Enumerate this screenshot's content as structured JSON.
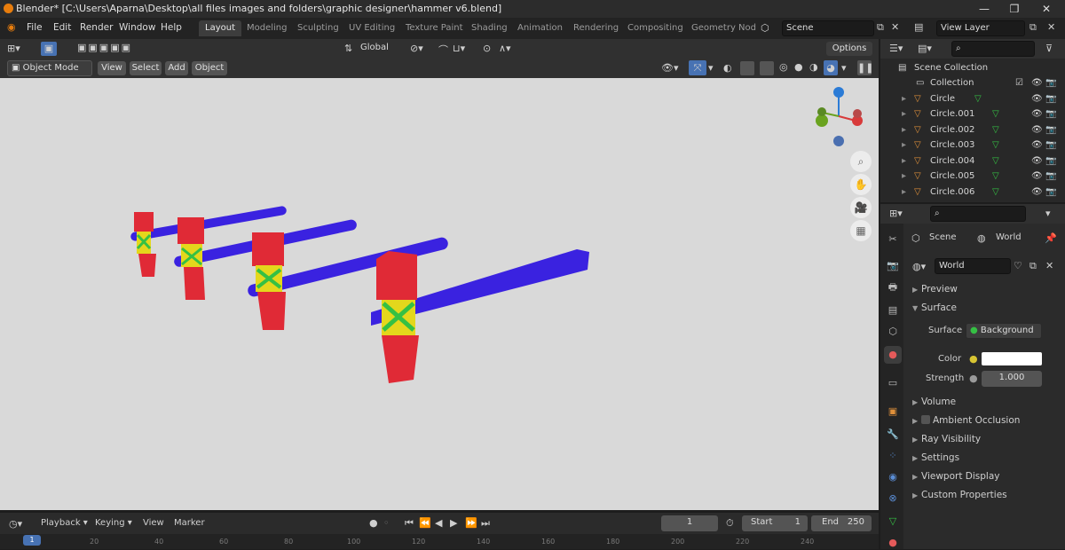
{
  "window": {
    "title": "Blender* [C:\\Users\\Aparna\\Desktop\\all files images and folders\\graphic designer\\hammer v6.blend]",
    "minimize": "—",
    "maximize": "❐",
    "close": "✕"
  },
  "menubar": {
    "items": [
      "File",
      "Edit",
      "Render",
      "Window",
      "Help"
    ],
    "workspaces": [
      "Layout",
      "Modeling",
      "Sculpting",
      "UV Editing",
      "Texture Paint",
      "Shading",
      "Animation",
      "Rendering",
      "Compositing",
      "Geometry Nod"
    ],
    "scene": "Scene",
    "view_layer": "View Layer"
  },
  "viewport_header": {
    "orientation": "Global",
    "options": "Options"
  },
  "viewport_tools": {
    "mode": "Object Mode",
    "menus": [
      "View",
      "Select",
      "Add",
      "Object"
    ]
  },
  "colors": {
    "handle": "#3a22e0",
    "head": "#e02a36",
    "band_yellow": "#e4d71c",
    "wrap_green": "#35c044",
    "accent": "#4772b3",
    "background": "#d9d9d9"
  },
  "outliner": {
    "root": "Scene Collection",
    "collection": "Collection",
    "objects": [
      "Circle",
      "Circle.001",
      "Circle.002",
      "Circle.003",
      "Circle.004",
      "Circle.005",
      "Circle.006"
    ]
  },
  "properties": {
    "scene_label": "Scene",
    "world_label": "World",
    "world_name": "World",
    "panels": {
      "preview": "Preview",
      "surface": "Surface",
      "volume": "Volume",
      "ambient_occlusion": "Ambient Occlusion",
      "ray_visibility": "Ray Visibility",
      "settings": "Settings",
      "viewport_display": "Viewport Display",
      "custom_properties": "Custom Properties"
    },
    "surface_label": "Surface",
    "surface_value": "Background",
    "color_label": "Color",
    "color_value": "#ffffff",
    "strength_label": "Strength",
    "strength_value": "1.000"
  },
  "timeline": {
    "menus": [
      "Playback",
      "Keying",
      "View",
      "Marker"
    ],
    "current_frame": "1",
    "start_label": "Start",
    "start_value": "1",
    "end_label": "End",
    "end_value": "250",
    "ticks": [
      "1",
      "20",
      "40",
      "60",
      "80",
      "100",
      "120",
      "140",
      "160",
      "180",
      "200",
      "220",
      "240"
    ]
  }
}
